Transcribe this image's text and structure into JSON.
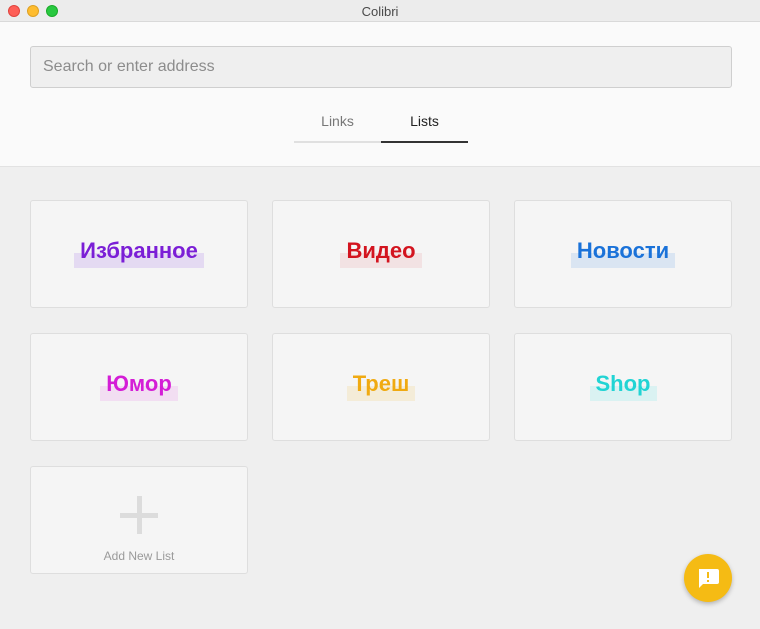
{
  "window": {
    "title": "Colibri"
  },
  "search": {
    "placeholder": "Search or enter address",
    "value": ""
  },
  "tabs": [
    {
      "label": "Links",
      "active": false
    },
    {
      "label": "Lists",
      "active": true
    }
  ],
  "lists": [
    {
      "label": "Избранное",
      "color": "#7b1fd6",
      "highlight": "#a77ce8"
    },
    {
      "label": "Видео",
      "color": "#d3141f",
      "highlight": "#e8a0a4"
    },
    {
      "label": "Новости",
      "color": "#1a72d9",
      "highlight": "#7aaee8"
    },
    {
      "label": "Юмор",
      "color": "#d41ed6",
      "highlight": "#e88ee8"
    },
    {
      "label": "Треш",
      "color": "#f0aa12",
      "highlight": "#f0cc70"
    },
    {
      "label": "Shop",
      "color": "#22d4d4",
      "highlight": "#7ce6e6"
    }
  ],
  "add_list": {
    "label": "Add New List",
    "icon": "plus-icon"
  },
  "fab": {
    "icon": "feedback-icon",
    "color": "#f5bb14"
  }
}
